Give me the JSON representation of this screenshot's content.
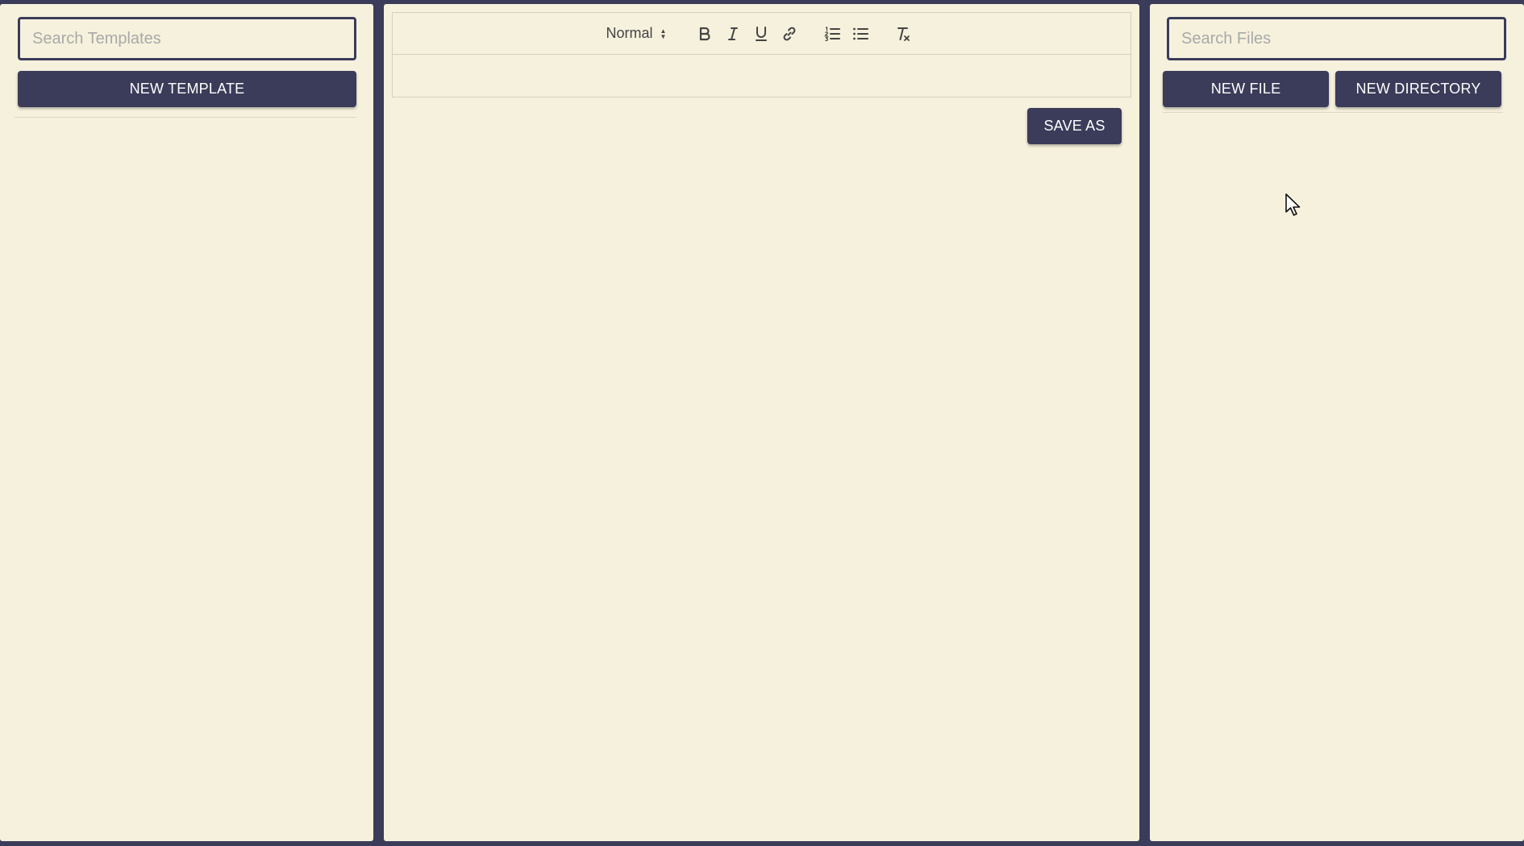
{
  "templates_panel": {
    "search_placeholder": "Search Templates",
    "new_template_label": "NEW TEMPLATE"
  },
  "editor": {
    "header_select": "Normal",
    "save_as_label": "SAVE AS"
  },
  "files_panel": {
    "search_placeholder": "Search Files",
    "new_file_label": "NEW FILE",
    "new_directory_label": "NEW DIRECTORY"
  },
  "colors": {
    "frame": "#3b3b5a",
    "panel_background": "#f5f1dc",
    "button": "#3b3b5a"
  }
}
